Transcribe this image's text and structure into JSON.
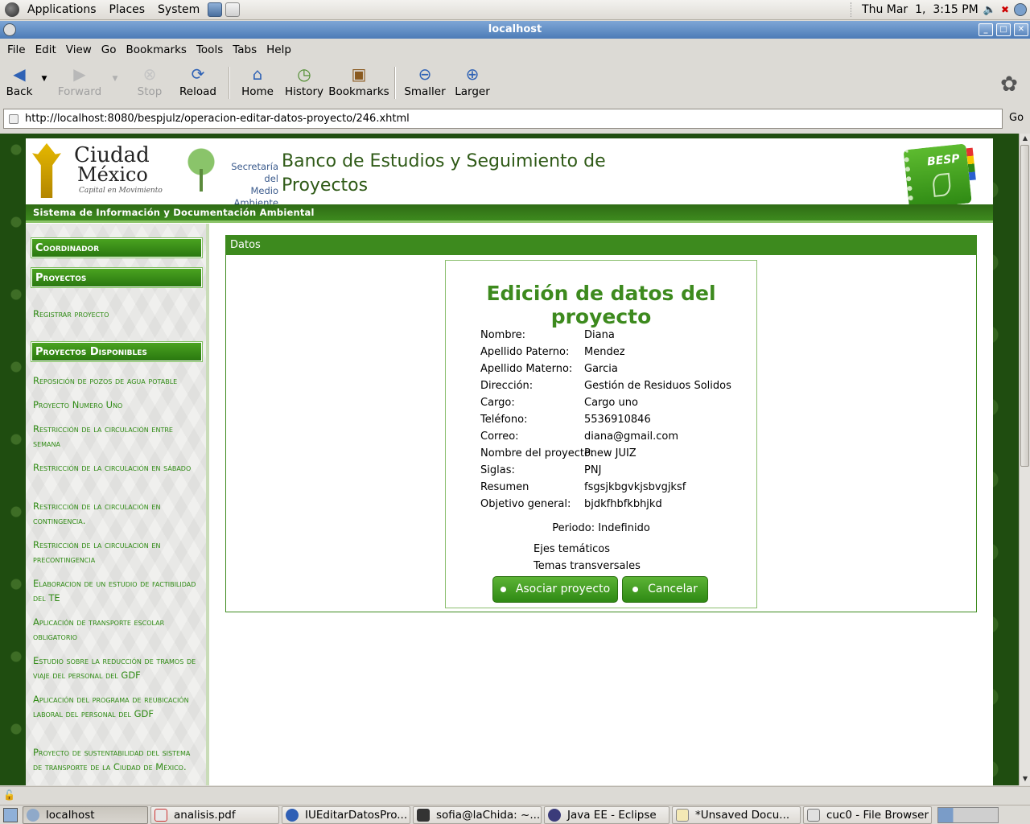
{
  "top_panel": {
    "menus": [
      "Applications",
      "Places",
      "System"
    ],
    "clock": "Thu Mar  1,  3:15 PM"
  },
  "window": {
    "title": "localhost"
  },
  "menubar": [
    "File",
    "Edit",
    "View",
    "Go",
    "Bookmarks",
    "Tools",
    "Tabs",
    "Help"
  ],
  "toolbar": {
    "back": "Back",
    "forward": "Forward",
    "stop": "Stop",
    "reload": "Reload",
    "home": "Home",
    "history": "History",
    "bookmarks": "Bookmarks",
    "smaller": "Smaller",
    "larger": "Larger"
  },
  "location": {
    "url": "http://localhost:8080/bespjulz/operacion-editar-datos-proyecto/246.xhtml",
    "go_label": "Go"
  },
  "header": {
    "cdmx_line1": "Ciudad",
    "cdmx_line2": "México",
    "cdmx_tag": "Capital en Movimiento",
    "sma_line1": "Secretaría del",
    "sma_line2": "Medio Ambiente",
    "site_title": "Banco de Estudios y Seguimiento de Proyectos",
    "besp_logo": "BESP",
    "subheader": "Sistema de Información y Documentación Ambiental"
  },
  "sidebar": {
    "coordinador": "Coordinador",
    "proyectos": "Proyectos",
    "registrar": "Registrar proyecto",
    "disponibles_head": "Proyectos Disponibles",
    "projects": [
      "Reposición de pozos de agua potable",
      "Proyecto Numero Uno",
      "Restricción de la circulación entre semana",
      "Restricción de la circulación en sábado",
      "Restricción de la circulación en contingencia.",
      "Restricción de la circulación en precontingencia",
      "Elaboracion de un estudio de factibilidad del TE",
      "Aplicación de transporte escolar obligatorio",
      "Estudio sobre la reducción de tramos de viaje del personal del GDF",
      "Aplicación del programa de reubicación laboral del personal del GDF",
      "Proyecto de sustentabilidad del sistema de transporte de la Ciudad de México."
    ]
  },
  "panel": {
    "head": "Datos",
    "form_title": "Edición de datos del proyecto",
    "fields": [
      {
        "label": "Nombre:",
        "value": "Diana"
      },
      {
        "label": "Apellido Paterno:",
        "value": "Mendez"
      },
      {
        "label": "Apellido Materno:",
        "value": "Garcia"
      },
      {
        "label": "Dirección:",
        "value": "Gestión de Residuos Solidos"
      },
      {
        "label": "Cargo:",
        "value": "Cargo uno"
      },
      {
        "label": "Teléfono:",
        "value": "5536910846"
      },
      {
        "label": "Correo:",
        "value": "diana@gmail.com"
      },
      {
        "label": "Nombre del proyecto:",
        "value": "Pnew JUIZ"
      },
      {
        "label": "Siglas:",
        "value": "PNJ"
      },
      {
        "label": "Resumen",
        "value": "fsgsjkbgvkjsbvgjksf"
      },
      {
        "label": "Objetivo general:",
        "value": "bjdkfhbfkbhjkd"
      }
    ],
    "periodo": "Periodo: Indefinido",
    "ejes": "Ejes temáticos",
    "temas": "Temas transversales",
    "btn_asociar": "Asociar proyecto",
    "btn_cancelar": "Cancelar"
  },
  "taskbar": [
    "localhost",
    "analisis.pdf",
    "IUEditarDatosPro...",
    "sofia@laChida: ~...",
    "Java EE - Eclipse",
    "*Unsaved Docu...",
    "cuc0 - File Browser"
  ],
  "colors": {
    "brand_green": "#3d8a1e",
    "link_green": "#2f8a14",
    "titlebar_blue": "#4c7bb7"
  }
}
